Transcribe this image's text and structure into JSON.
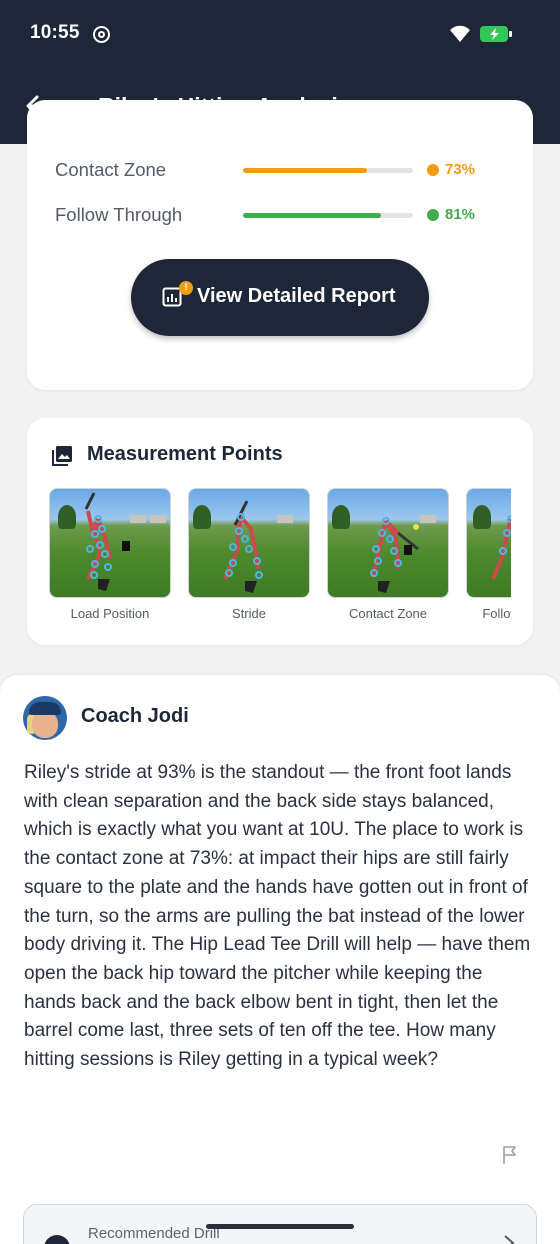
{
  "status_bar": {
    "time": "10:55"
  },
  "app_bar": {
    "title": "Riley's Hitting Analysis"
  },
  "metrics": [
    {
      "label": "Contact Zone",
      "value": "73%",
      "fraction": 0.73,
      "color": "#f39c12"
    },
    {
      "label": "Follow Through",
      "value": "81%",
      "fraction": 0.81,
      "color": "#3fad4a"
    }
  ],
  "report_button": {
    "label": "View Detailed Report",
    "badge": "!"
  },
  "measurement": {
    "heading": "Measurement Points",
    "thumbnails": [
      {
        "caption": "Load Position"
      },
      {
        "caption": "Stride"
      },
      {
        "caption": "Contact Zone"
      },
      {
        "caption": "Follow Through"
      }
    ]
  },
  "coach": {
    "name": "Coach Jodi",
    "message": "Riley's stride at 93% is the standout — the front foot lands with clean separation and the back side stays balanced, which is exactly what you want at 10U. The place to work is the contact zone at 73%: at impact their hips are still fairly square to the plate and the hands have gotten out in front of the turn, so the arms are pulling the bat instead of the lower body driving it. The Hip Lead Tee Drill will help — have them open the back hip toward the pitcher while keeping the hands back and the back elbow bent in tight, then let the barrel come last, three sets of ten off the tee. How many hitting sessions is Riley getting in a typical week?"
  },
  "drill": {
    "label": "Recommended Drill"
  }
}
